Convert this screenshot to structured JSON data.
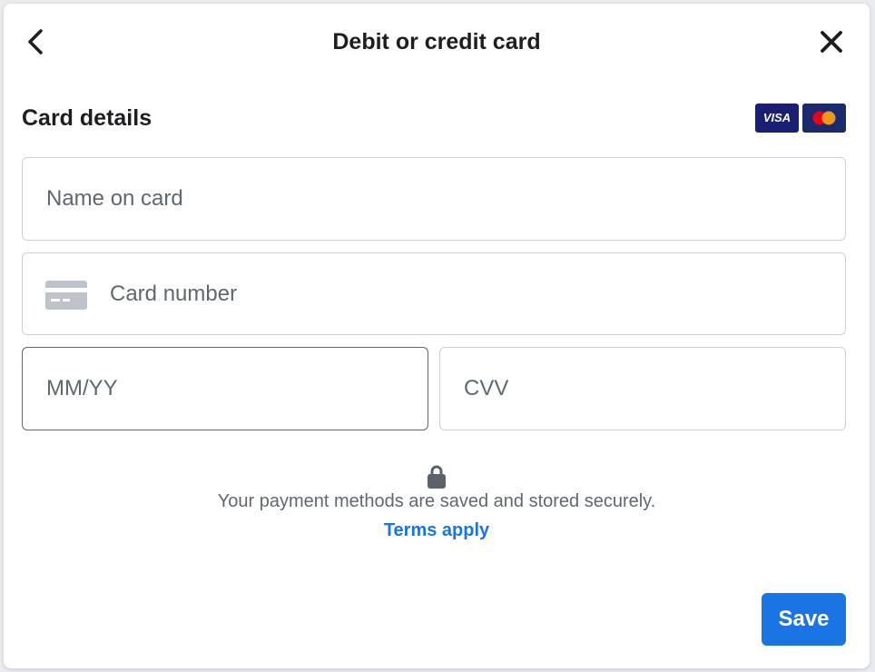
{
  "header": {
    "title": "Debit or credit card",
    "back_icon": "chevron-left-icon",
    "close_icon": "close-icon"
  },
  "card_details": {
    "title": "Card details",
    "brands": [
      {
        "name": "visa-logo",
        "label": "VISA"
      },
      {
        "name": "mastercard-logo"
      }
    ]
  },
  "form": {
    "name_on_card": {
      "placeholder": "Name on card",
      "value": ""
    },
    "card_number": {
      "placeholder": "Card number",
      "value": "",
      "icon": "credit-card-icon"
    },
    "expiry": {
      "placeholder": "MM/YY",
      "value": ""
    },
    "cvv": {
      "placeholder": "CVV",
      "value": ""
    }
  },
  "security": {
    "icon": "lock-icon",
    "text": "Your payment methods are saved and stored securely.",
    "terms_link": "Terms apply"
  },
  "actions": {
    "save_label": "Save"
  },
  "colors": {
    "accent": "#1b74e4",
    "text_primary": "#1c1e21",
    "text_secondary": "#606770",
    "border": "#ccd0d5",
    "visa_brand": "#1a1f71",
    "mastercard_red": "#eb001b",
    "mastercard_yellow": "#f79e1b"
  }
}
